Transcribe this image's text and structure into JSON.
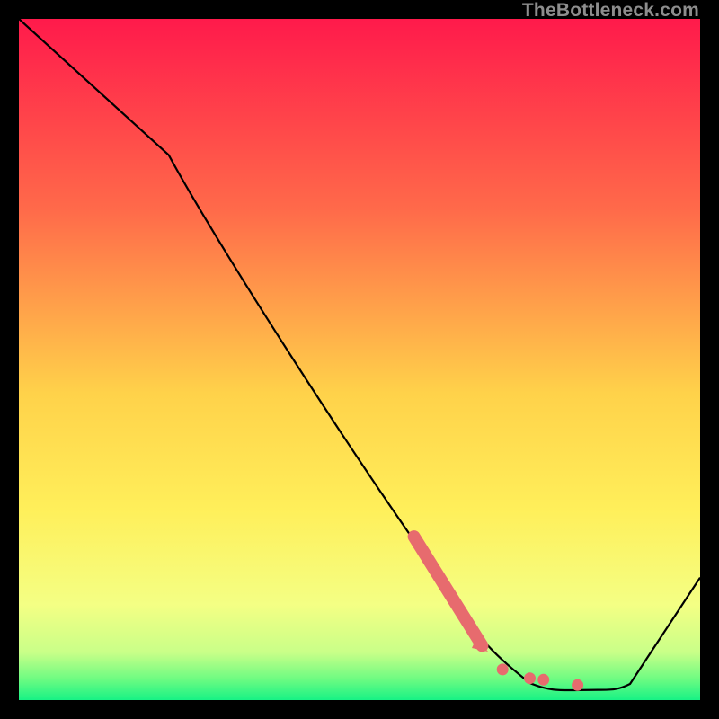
{
  "watermark": "TheBottleneck.com",
  "colors": {
    "black": "#000000",
    "curve": "#000000",
    "marker": "#e76b6e",
    "grad_top": "#ff1a4b",
    "grad_orange": "#ffa54a",
    "grad_yellow": "#ffef5a",
    "grad_ltyellow": "#faff8c",
    "grad_green": "#17f285"
  },
  "chart_data": {
    "type": "line",
    "title": "",
    "xlabel": "",
    "ylabel": "",
    "xlim": [
      0,
      100
    ],
    "ylim": [
      0,
      100
    ],
    "x": [
      0,
      22,
      64,
      70,
      75,
      80,
      85,
      88,
      100
    ],
    "y": [
      100,
      80,
      15,
      6.5,
      2.5,
      1.5,
      1.5,
      1.5,
      18
    ],
    "markers": {
      "thick_segment": {
        "x0": 58,
        "y0": 24,
        "x1": 68,
        "y1": 8
      },
      "dots": [
        {
          "x": 71,
          "y": 4.5
        },
        {
          "x": 75,
          "y": 3.2
        },
        {
          "x": 77,
          "y": 3.0
        },
        {
          "x": 82,
          "y": 2.2
        }
      ]
    }
  }
}
